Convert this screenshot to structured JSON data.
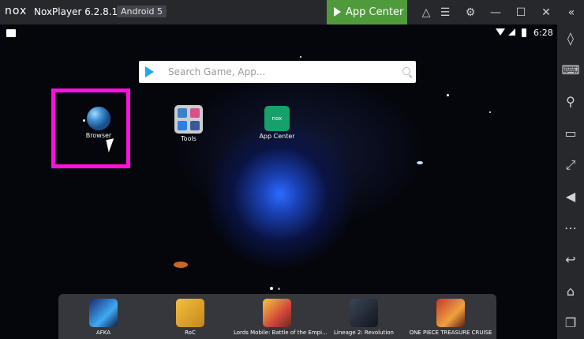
{
  "window": {
    "logo": "nox",
    "title": "NoxPlayer 6.2.8.1",
    "android_version": "Android 5",
    "app_center_button": "App Center",
    "toolbar_icons": [
      "shirt-icon",
      "menu-icon",
      "settings-icon",
      "minimize-icon",
      "maximize-icon",
      "close-icon",
      "collapse-icon"
    ]
  },
  "statusbar": {
    "time": "6:28"
  },
  "search": {
    "placeholder": "Search Game, App..."
  },
  "desktop_apps": [
    {
      "label": "Browser",
      "icon": "browser-globe-icon"
    },
    {
      "label": "Tools",
      "icon": "tools-folder-icon"
    },
    {
      "label": "App Center",
      "icon": "nox-app-center-icon",
      "icon_text": "nox"
    }
  ],
  "page_indicator": {
    "count": 2,
    "active": 0
  },
  "dock": [
    {
      "label": "AFKA",
      "icon": "afka-icon"
    },
    {
      "label": "RoC",
      "icon": "roc-icon"
    },
    {
      "label": "Lords Mobile: Battle of the Empi...",
      "icon": "lords-mobile-icon"
    },
    {
      "label": "Lineage 2: Revolution",
      "icon": "lineage2-icon"
    },
    {
      "label": "ONE PIECE TREASURE CRUISE",
      "icon": "one-piece-icon"
    }
  ],
  "sidebar_icons": [
    "screen-rotate-icon",
    "keyboard-icon",
    "location-icon",
    "screen-icon",
    "fullscreen-icon",
    "volume-icon",
    "more-icon",
    "back-icon",
    "home-icon",
    "recent-apps-icon"
  ],
  "colors": {
    "titlebar": "#26282c",
    "app_center_green": "#4f9b3c",
    "highlight_magenta": "#ff10e0"
  }
}
